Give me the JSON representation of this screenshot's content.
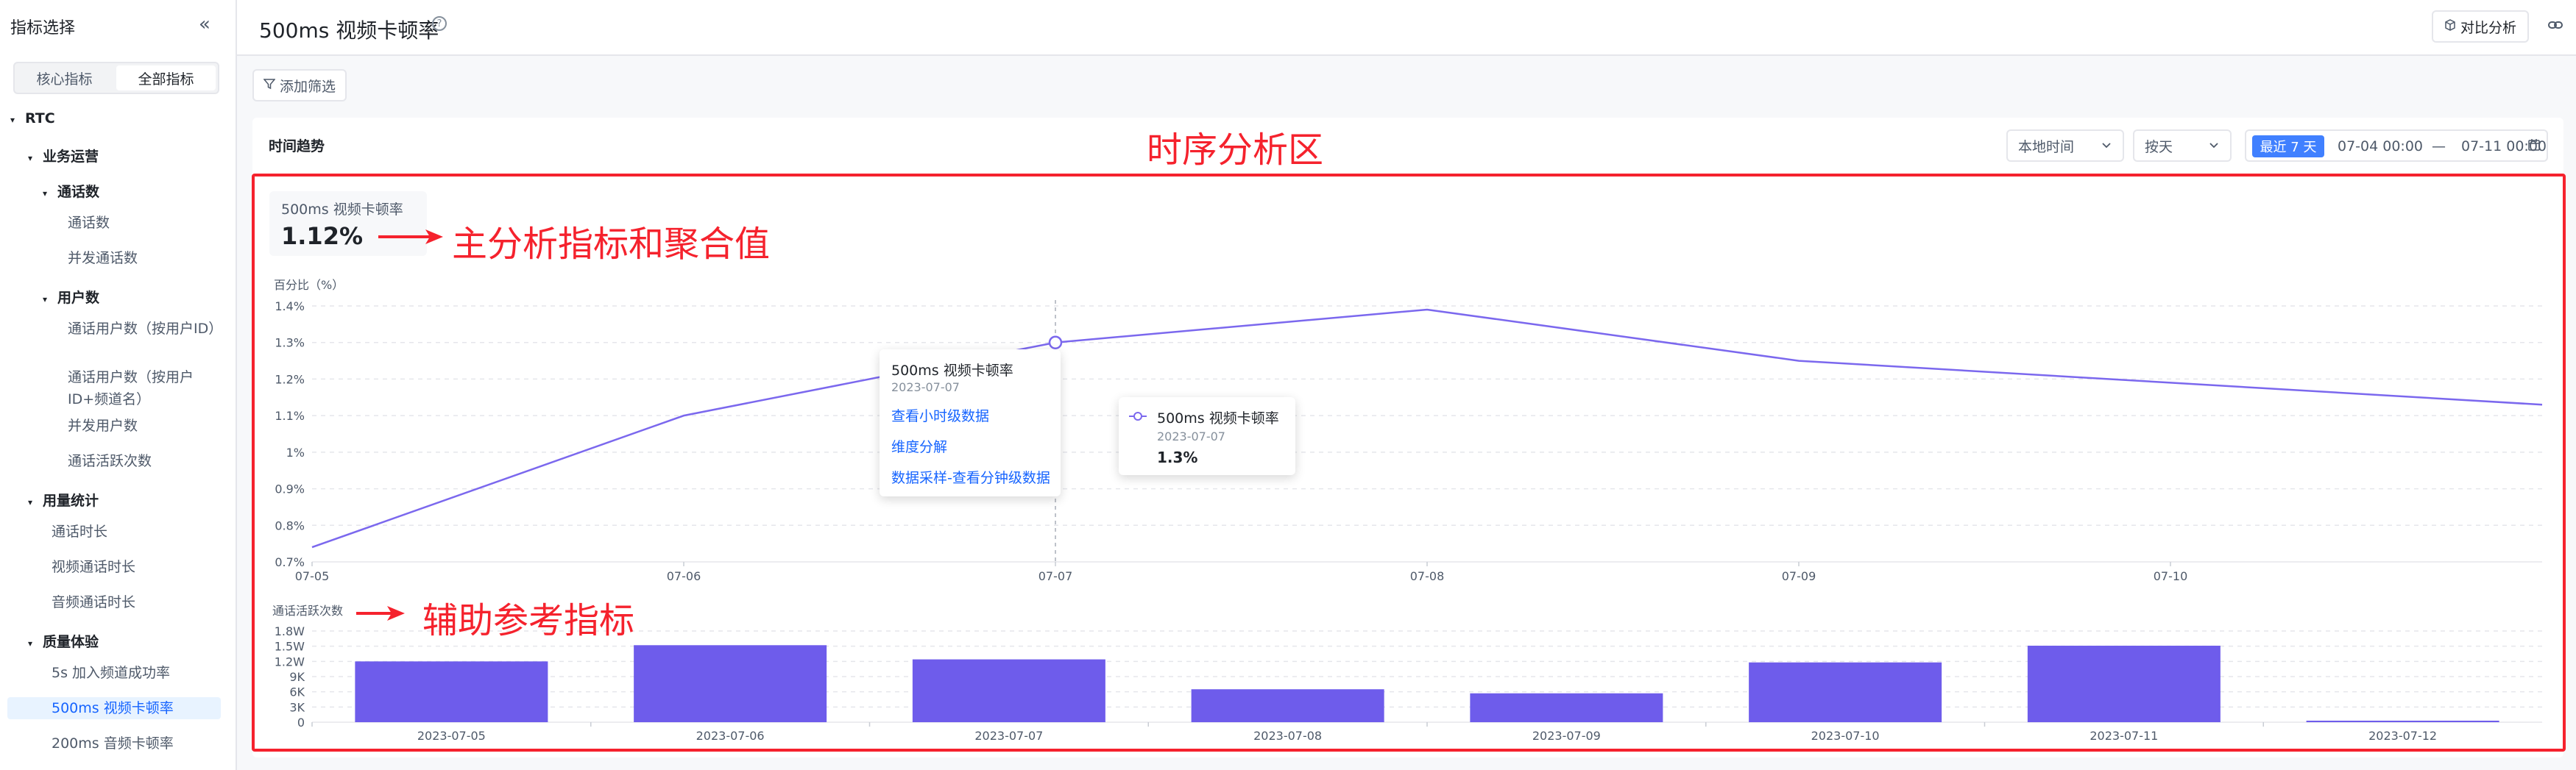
{
  "sidebar": {
    "title": "指标选择",
    "tabs": [
      "核心指标",
      "全部指标"
    ],
    "tree": [
      {
        "label": "RTC",
        "level": 0,
        "bold": true
      },
      {
        "label": "业务运营",
        "level": 1,
        "bold": true
      },
      {
        "label": "通话数",
        "level": 2,
        "bold": true
      },
      {
        "label": "通话数",
        "level": 3
      },
      {
        "label": "并发通话数",
        "level": 3
      },
      {
        "label": "用户数",
        "level": 2,
        "bold": true
      },
      {
        "label": "通话用户数（按用户ID）",
        "level": 3
      },
      {
        "label": "通话用户数（按用户ID+频道名）",
        "level": 3
      },
      {
        "label": "并发用户数",
        "level": 3
      },
      {
        "label": "通话活跃次数",
        "level": 3
      },
      {
        "label": "用量统计",
        "level": 1,
        "bold": true
      },
      {
        "label": "通话时长",
        "level": 2
      },
      {
        "label": "视频通话时长",
        "level": 2
      },
      {
        "label": "音频通话时长",
        "level": 2
      },
      {
        "label": "质量体验",
        "level": 1,
        "bold": true
      },
      {
        "label": "5s 加入频道成功率",
        "level": 2
      },
      {
        "label": "500ms 视频卡顿率",
        "level": 2,
        "selected": true
      },
      {
        "label": "200ms 音频卡顿率",
        "level": 2
      }
    ]
  },
  "header": {
    "title": "500ms 视频卡顿率",
    "compare_label": "对比分析"
  },
  "toolbar": {
    "add_filter_label": "添加筛选"
  },
  "trend": {
    "title": "时间趋势",
    "timezone": "本地时间",
    "granularity": "按天",
    "recent_label": "最近 7 天",
    "date_start": "07-04 00:00",
    "date_sep": "—",
    "date_end": "07-11 00:00"
  },
  "main_metric": {
    "name": "500ms 视频卡顿率",
    "value": "1.12%"
  },
  "annotations": {
    "region": "时序分析区",
    "main": "主分析指标和聚合值",
    "aux": "辅助参考指标"
  },
  "tooltip_menu": {
    "title": "500ms 视频卡顿率",
    "date": "2023-07-07",
    "items": [
      "查看小时级数据",
      "维度分解",
      "数据采样-查看分钟级数据"
    ]
  },
  "tooltip_card": {
    "series": "500ms 视频卡顿率",
    "date": "2023-07-07",
    "value": "1.3%"
  },
  "colors": {
    "line": "#7b68ee",
    "bar": "#6e5ceb",
    "accent": "#1664ff",
    "annotation": "#f5222d"
  },
  "chart_data": [
    {
      "type": "line",
      "ylabel": "百分比（%）",
      "x": [
        "07-05",
        "07-06",
        "07-07",
        "07-08",
        "07-09",
        "07-10",
        "07-11"
      ],
      "x_tick_labels": [
        "07-05",
        "07-06",
        "07-07",
        "07-08",
        "07-09",
        "07-10"
      ],
      "series": [
        {
          "name": "500ms 视频卡顿率",
          "values": [
            0.74,
            1.1,
            1.3,
            1.39,
            1.25,
            1.19,
            1.13
          ]
        }
      ],
      "yticks": [
        "0.7%",
        "0.8%",
        "0.9%",
        "1%",
        "1.1%",
        "1.2%",
        "1.3%",
        "1.4%"
      ],
      "ylim": [
        0.7,
        1.4
      ],
      "highlight": "07-07",
      "grid": true
    },
    {
      "type": "bar",
      "ylabel": "通话活跃次数",
      "categories": [
        "2023-07-05",
        "2023-07-06",
        "2023-07-07",
        "2023-07-08",
        "2023-07-09",
        "2023-07-10",
        "2023-07-11",
        "2023-07-12"
      ],
      "values": [
        12000,
        15200,
        12400,
        6500,
        5700,
        11800,
        15100,
        300
      ],
      "yticks": [
        "0",
        "3K",
        "6K",
        "9K",
        "1.2W",
        "1.5W",
        "1.8W"
      ],
      "ylim": [
        0,
        18000
      ],
      "grid": true
    }
  ]
}
